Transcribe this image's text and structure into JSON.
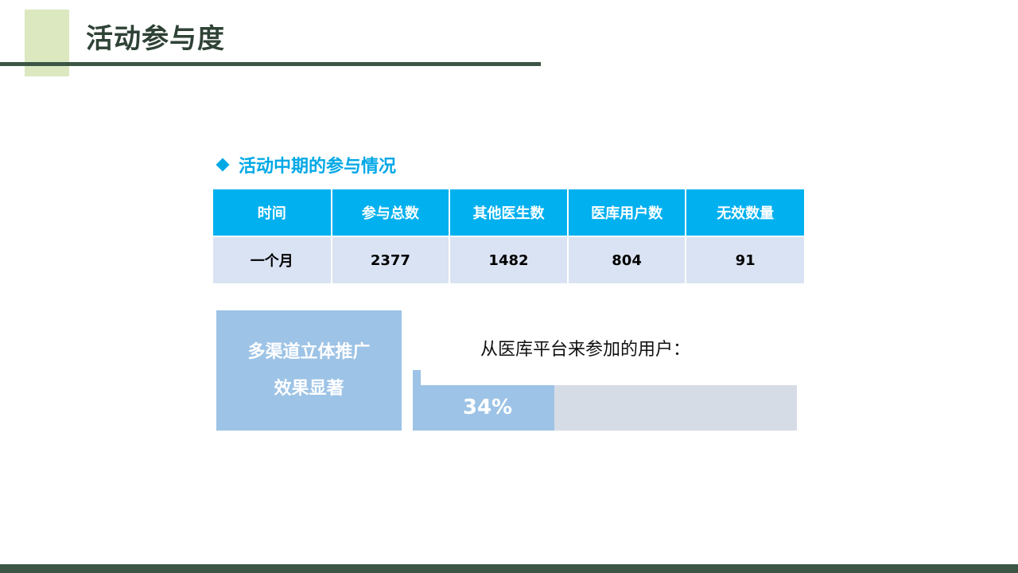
{
  "header": {
    "title": "活动参与度"
  },
  "section": {
    "heading": "活动中期的参与情况"
  },
  "table": {
    "columns": [
      "时间",
      "参与总数",
      "其他医生数",
      "医库用户数",
      "无效数量"
    ],
    "rows": [
      [
        "一个月",
        "2377",
        "1482",
        "804",
        "91"
      ]
    ]
  },
  "promo": {
    "line1": "多渠道立体推广",
    "line2": "效果显著"
  },
  "stat": {
    "label": "从医库平台来参加的用户：",
    "value_text": "34%",
    "fraction": 0.34
  },
  "colors": {
    "accent_green": "#3c5545",
    "header_block": "#dce8c0",
    "table_header": "#00b0ef",
    "table_row": "#dae3f3",
    "light_blue": "#9dc3e6",
    "track_gray": "#d6dce6",
    "heading_blue": "#00a8e6"
  }
}
